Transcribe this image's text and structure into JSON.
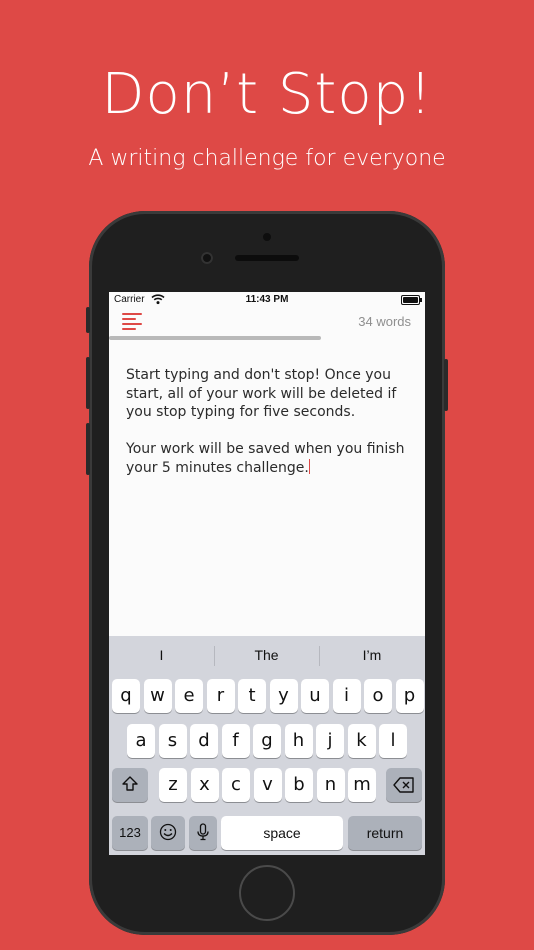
{
  "headline": "Don’t Stop!",
  "subheadline": "A writing challenge for everyone",
  "status_bar": {
    "carrier": "Carrier",
    "time": "11:43 PM"
  },
  "app": {
    "word_count": "34 words",
    "timer_progress": 0.67,
    "paragraphs": [
      "Start typing and don't stop! Once you start, all of your work will be deleted if you stop typing for five seconds.",
      "Your work will be saved when you finish your 5 minutes challenge."
    ]
  },
  "keyboard": {
    "suggestions": [
      "I",
      "The",
      "I’m"
    ],
    "row1": [
      "q",
      "w",
      "e",
      "r",
      "t",
      "y",
      "u",
      "i",
      "o",
      "p"
    ],
    "row2": [
      "a",
      "s",
      "d",
      "f",
      "g",
      "h",
      "j",
      "k",
      "l"
    ],
    "row3": [
      "z",
      "x",
      "c",
      "v",
      "b",
      "n",
      "m"
    ],
    "numbers_key": "123",
    "space_key": "space",
    "return_key": "return"
  },
  "colors": {
    "background": "#de4946",
    "accent": "#de4946"
  },
  "icons": [
    "wifi-icon",
    "battery-icon",
    "menu-icon",
    "shift-icon",
    "delete-icon",
    "emoji-icon",
    "microphone-icon"
  ]
}
